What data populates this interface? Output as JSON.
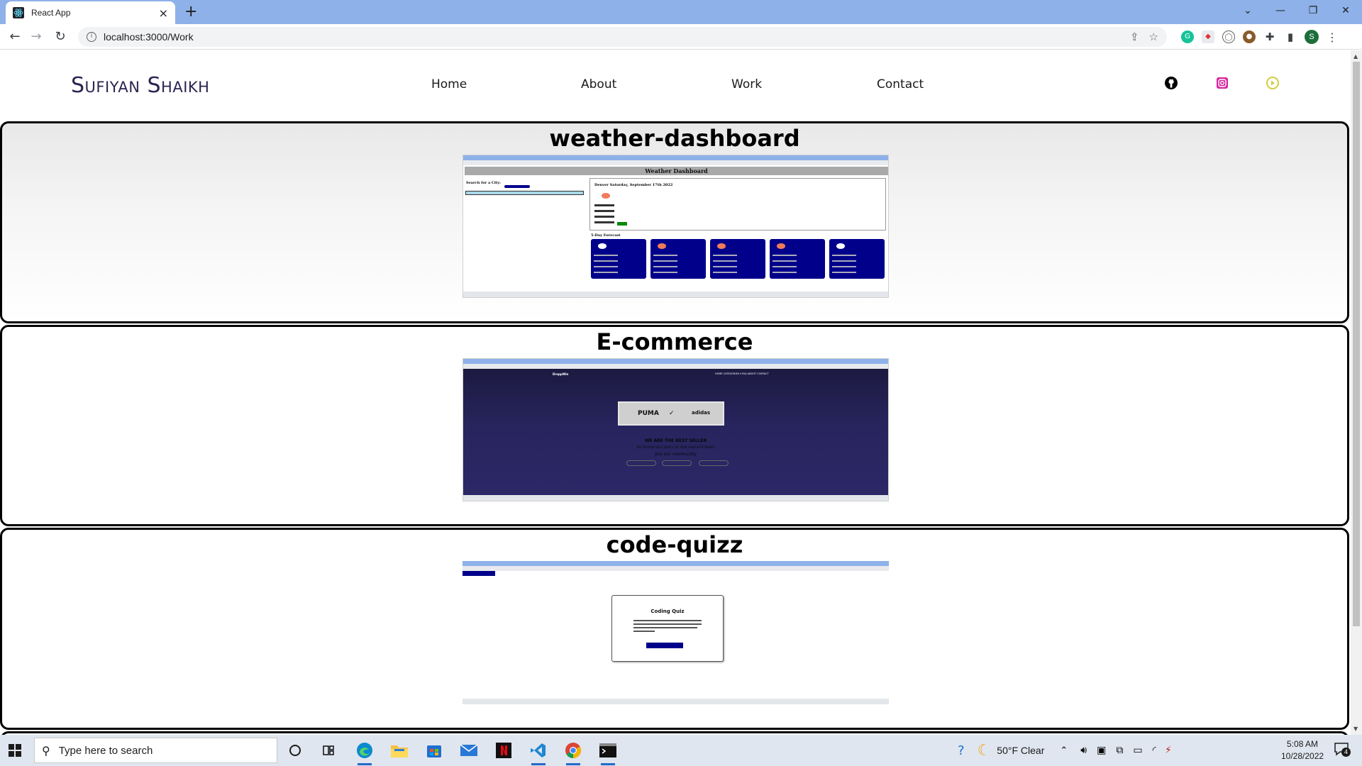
{
  "browser": {
    "tab_title": "React App",
    "tab_close": "×",
    "new_tab": "+",
    "url": "localhost:3000/Work",
    "window_controls": [
      "⌄",
      "—",
      "❐",
      "✕"
    ],
    "profile_initial": "S"
  },
  "site": {
    "logo": "Sufiyan Shaikh",
    "nav": [
      "Home",
      "About",
      "Work",
      "Contact"
    ],
    "social": [
      "github-icon",
      "instagram-icon",
      "youtube-icon"
    ],
    "colors": {
      "logo": "#2a2550",
      "instagram": "#d6249f",
      "youtube": "#cfcf40"
    }
  },
  "projects": [
    {
      "title": "weather-dashboard"
    },
    {
      "title": "E-commerce"
    },
    {
      "title": "code-quizz"
    }
  ],
  "shots": {
    "weather": {
      "header": "Weather Dashboard",
      "search_label": "Search for a City:",
      "city_line": "Denver Saturday, September 17th 2022",
      "forecast_label": "5-Day Forecast"
    },
    "ecommerce": {
      "brand": "DroppWin",
      "nav": "HOME  CATEGORIES ▾  FAQ  ABOUT  CONTACT",
      "logos": [
        "PUMA",
        "✓",
        "adidas"
      ],
      "heading": "WE ARE THE BEST SELLER",
      "sub": "WE PROVIDE BEST DEALS ON YOUR FAVOURITE BRAND",
      "join": "Join our community"
    },
    "quiz": {
      "title": "Coding Quiz"
    }
  },
  "taskbar": {
    "search_placeholder": "Type here to search",
    "weather": "50°F  Clear",
    "time": "5:08 AM",
    "date": "10/28/2022",
    "notifications": "4"
  }
}
